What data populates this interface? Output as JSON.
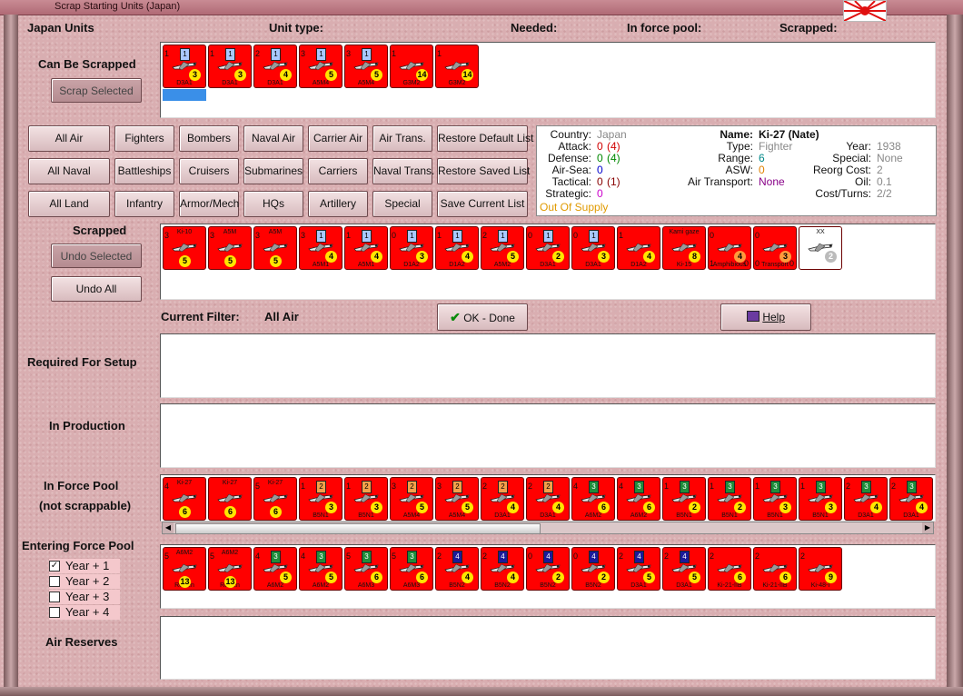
{
  "window": {
    "title": "Scrap Starting Units (Japan)"
  },
  "header": {
    "units": "Japan Units",
    "unit_type": "Unit type:",
    "needed": "Needed:",
    "force_pool": "In force pool:",
    "scrapped": "Scrapped:"
  },
  "sections": {
    "can_be_scrapped": "Can Be Scrapped",
    "scrapped": "Scrapped",
    "required_for_setup": "Required For Setup",
    "in_production": "In Production",
    "in_force_pool_1": "In Force Pool",
    "in_force_pool_2": "(not scrappable)",
    "entering_force_pool": "Entering Force Pool",
    "air_reserves": "Air Reserves"
  },
  "buttons": {
    "scrap_selected": "Scrap Selected",
    "undo_selected": "Undo Selected",
    "undo_all": "Undo All",
    "ok_done": "OK - Done",
    "help": "Help"
  },
  "filters": [
    [
      "All Air",
      "Fighters",
      "Bombers",
      "Naval Air",
      "Carrier Air",
      "Air Trans.",
      "Restore Default List"
    ],
    [
      "All Naval",
      "Battleships",
      "Cruisers",
      "Submarines",
      "Carriers",
      "Naval Trans.",
      "Restore Saved List"
    ],
    [
      "All Land",
      "Infantry",
      "Armor/Mech",
      "HQs",
      "Artillery",
      "Special",
      "Save Current List"
    ]
  ],
  "current_filter": {
    "label": "Current Filter:",
    "value": "All Air"
  },
  "info": {
    "left": [
      {
        "k": "Country:",
        "v": "Japan",
        "c": "#888"
      },
      {
        "k": "Attack:",
        "v": "0",
        "v2": "(4)",
        "c": "#d00000"
      },
      {
        "k": "Defense:",
        "v": "0",
        "v2": "(4)",
        "c": "#008800"
      },
      {
        "k": "Air-Sea:",
        "v": "0",
        "c": "#0000cc"
      },
      {
        "k": "Tactical:",
        "v": "0",
        "v2": "(1)",
        "c": "#880000"
      },
      {
        "k": "Strategic:",
        "v": "0",
        "c": "#cc00cc"
      }
    ],
    "supply": "Out Of Supply",
    "mid": [
      {
        "k": "Name:",
        "v": "Ki-27 (Nate)",
        "c": "#111"
      },
      {
        "k": "Type:",
        "v": "Fighter",
        "c": "#888"
      },
      {
        "k": "Range:",
        "v": "6",
        "c": "#008888"
      },
      {
        "k": "ASW:",
        "v": "0",
        "c": "#e08000"
      },
      {
        "k": "Air Transport:",
        "v": "None",
        "c": "#880088"
      }
    ],
    "right": [
      {
        "k": "Year:",
        "v": "1938",
        "c": "#888"
      },
      {
        "k": "Special:",
        "v": "None",
        "c": "#888"
      },
      {
        "k": "Reorg Cost:",
        "v": "2",
        "c": "#888"
      },
      {
        "k": "Oil:",
        "v": "0.1",
        "c": "#888"
      },
      {
        "k": "Cost/Turns:",
        "v": "2/2",
        "c": "#888"
      }
    ]
  },
  "can_be_scrapped_units": [
    {
      "n": "D3A1",
      "s": "1",
      "ul": "",
      "b": "1",
      "bc": "",
      "c": "3"
    },
    {
      "n": "D3A1",
      "s": "1",
      "ul": "",
      "b": "1",
      "bc": "",
      "c": "3"
    },
    {
      "n": "D3A1",
      "s": "2",
      "ul": "",
      "b": "1",
      "bc": "",
      "c": "4"
    },
    {
      "n": "A5M4",
      "s": "3",
      "ul": "",
      "b": "1",
      "bc": "",
      "c": "5"
    },
    {
      "n": "A5M4",
      "s": "3",
      "ul": "",
      "b": "1",
      "bc": "",
      "c": "5"
    },
    {
      "n": "G3M2",
      "s": "1",
      "ul": "",
      "b": "",
      "bc": "",
      "c": "14"
    },
    {
      "n": "G3M2",
      "s": "1",
      "ul": "",
      "b": "",
      "bc": "",
      "c": "14"
    }
  ],
  "scrapped_units": [
    {
      "n": "",
      "tn": "Ki-10",
      "s": "3",
      "b": "",
      "c": "5",
      "cc": "c2"
    },
    {
      "n": "",
      "tn": "A5M",
      "s": "3",
      "b": "",
      "c": "5",
      "cc": "c2"
    },
    {
      "n": "",
      "tn": "A5M",
      "s": "3",
      "b": "",
      "c": "5",
      "cc": "c2"
    },
    {
      "n": "A5M1",
      "s": "3",
      "b": "1",
      "c": "4"
    },
    {
      "n": "A5M1",
      "s": "1",
      "b": "1",
      "c": "4"
    },
    {
      "n": "D1A2",
      "s": "0",
      "b": "1",
      "c": "3"
    },
    {
      "n": "D1A2",
      "s": "1",
      "b": "1",
      "c": "4"
    },
    {
      "n": "A5M2",
      "s": "2",
      "b": "1",
      "c": "5"
    },
    {
      "n": "D3A1",
      "s": "0",
      "b": "1",
      "c": "2"
    },
    {
      "n": "D3A1",
      "s": "0",
      "b": "1",
      "c": "3"
    },
    {
      "n": "D1A2",
      "s": "1",
      "b": "",
      "c": "4"
    },
    {
      "n": "Ki-15",
      "s": "",
      "b": "",
      "c": "8",
      "tn": "Kami gaze"
    },
    {
      "n": "Amphibious",
      "s": "0",
      "b": "",
      "c": "4",
      "cc": "or",
      "bl": "1",
      "br": "0"
    },
    {
      "n": "Transport",
      "s": "0",
      "b": "",
      "c": "3",
      "cc": "or",
      "bl": "0",
      "br": "0"
    },
    {
      "n": "",
      "s": "",
      "b": "",
      "c": "2",
      "cc": "gray",
      "tn": "XX",
      "white": true
    }
  ],
  "force_pool_units": [
    {
      "n": "",
      "tn": "Ki-27",
      "s": "4",
      "b": "",
      "c": "6",
      "cc": "c2"
    },
    {
      "n": "",
      "tn": "Ki-27",
      "s": "",
      "b": "",
      "c": "6",
      "cc": "c2"
    },
    {
      "n": "",
      "tn": "Ki-27",
      "s": "5",
      "b": "",
      "c": "6",
      "cc": "c2"
    },
    {
      "n": "B5N1",
      "s": "1",
      "b": "2",
      "bc": "o",
      "c": "3"
    },
    {
      "n": "B5N1",
      "s": "1",
      "b": "2",
      "bc": "o",
      "c": "3"
    },
    {
      "n": "A5M4",
      "s": "3",
      "b": "2",
      "bc": "o",
      "c": "5"
    },
    {
      "n": "A5M4",
      "s": "3",
      "b": "2",
      "bc": "o",
      "c": "5"
    },
    {
      "n": "D3A1",
      "s": "2",
      "b": "2",
      "bc": "o",
      "c": "4"
    },
    {
      "n": "D3A1",
      "s": "2",
      "b": "2",
      "bc": "o",
      "c": "4"
    },
    {
      "n": "A6M2",
      "s": "4",
      "b": "3",
      "bc": "g",
      "c": "6"
    },
    {
      "n": "A6M2",
      "s": "4",
      "b": "3",
      "bc": "g",
      "c": "6"
    },
    {
      "n": "B5N1",
      "s": "1",
      "b": "3",
      "bc": "g",
      "c": "2"
    },
    {
      "n": "B5N1",
      "s": "1",
      "b": "3",
      "bc": "g",
      "c": "2"
    },
    {
      "n": "B5N1",
      "s": "1",
      "b": "3",
      "bc": "g",
      "c": "3"
    },
    {
      "n": "B5N1",
      "s": "1",
      "b": "3",
      "bc": "g",
      "c": "3"
    },
    {
      "n": "D3A1",
      "s": "2",
      "b": "3",
      "bc": "g",
      "c": "4"
    },
    {
      "n": "D3A1",
      "s": "2",
      "b": "3",
      "bc": "g",
      "c": "4"
    }
  ],
  "entering_units": [
    {
      "n": "Reisen",
      "tn": "A6M2",
      "s": "5",
      "b": "",
      "c": "13",
      "cc": "c2"
    },
    {
      "n": "Reisen",
      "tn": "A6M2",
      "s": "5",
      "b": "",
      "c": "13",
      "cc": "c2"
    },
    {
      "n": "A6M2",
      "s": "4",
      "b": "3",
      "bc": "g",
      "c": "5"
    },
    {
      "n": "A6M2",
      "s": "4",
      "b": "3",
      "bc": "g",
      "c": "5"
    },
    {
      "n": "A6M3",
      "s": "5",
      "b": "3",
      "bc": "g",
      "c": "6"
    },
    {
      "n": "A6M3",
      "s": "5",
      "b": "3",
      "bc": "g",
      "c": "6"
    },
    {
      "n": "B5N2",
      "s": "2",
      "b": "4",
      "bc": "n",
      "c": "4"
    },
    {
      "n": "B5N2",
      "s": "2",
      "b": "4",
      "bc": "n",
      "c": "4"
    },
    {
      "n": "B5N2",
      "s": "0",
      "b": "4",
      "bc": "n",
      "c": "2"
    },
    {
      "n": "B5N2",
      "s": "0",
      "b": "4",
      "bc": "n",
      "c": "2"
    },
    {
      "n": "D3A1",
      "s": "2",
      "b": "4",
      "bc": "n",
      "c": "5"
    },
    {
      "n": "D3A1",
      "s": "2",
      "b": "4",
      "bc": "n",
      "c": "5"
    },
    {
      "n": "Ki-21-IIB",
      "s": "2",
      "b": "",
      "c": "6"
    },
    {
      "n": "Ki-21-IIB",
      "s": "2",
      "b": "",
      "c": "6"
    },
    {
      "n": "Ki-48-I",
      "s": "2",
      "b": "",
      "c": "9"
    }
  ],
  "year_checks": [
    {
      "label": "Year + 1",
      "checked": true
    },
    {
      "label": "Year + 2",
      "checked": false
    },
    {
      "label": "Year + 3",
      "checked": false
    },
    {
      "label": "Year + 4",
      "checked": false
    }
  ],
  "colors": {
    "counter_red": "#ff0000",
    "panel_bg": "#d9aeb1",
    "selection": "#3a8fe8"
  }
}
